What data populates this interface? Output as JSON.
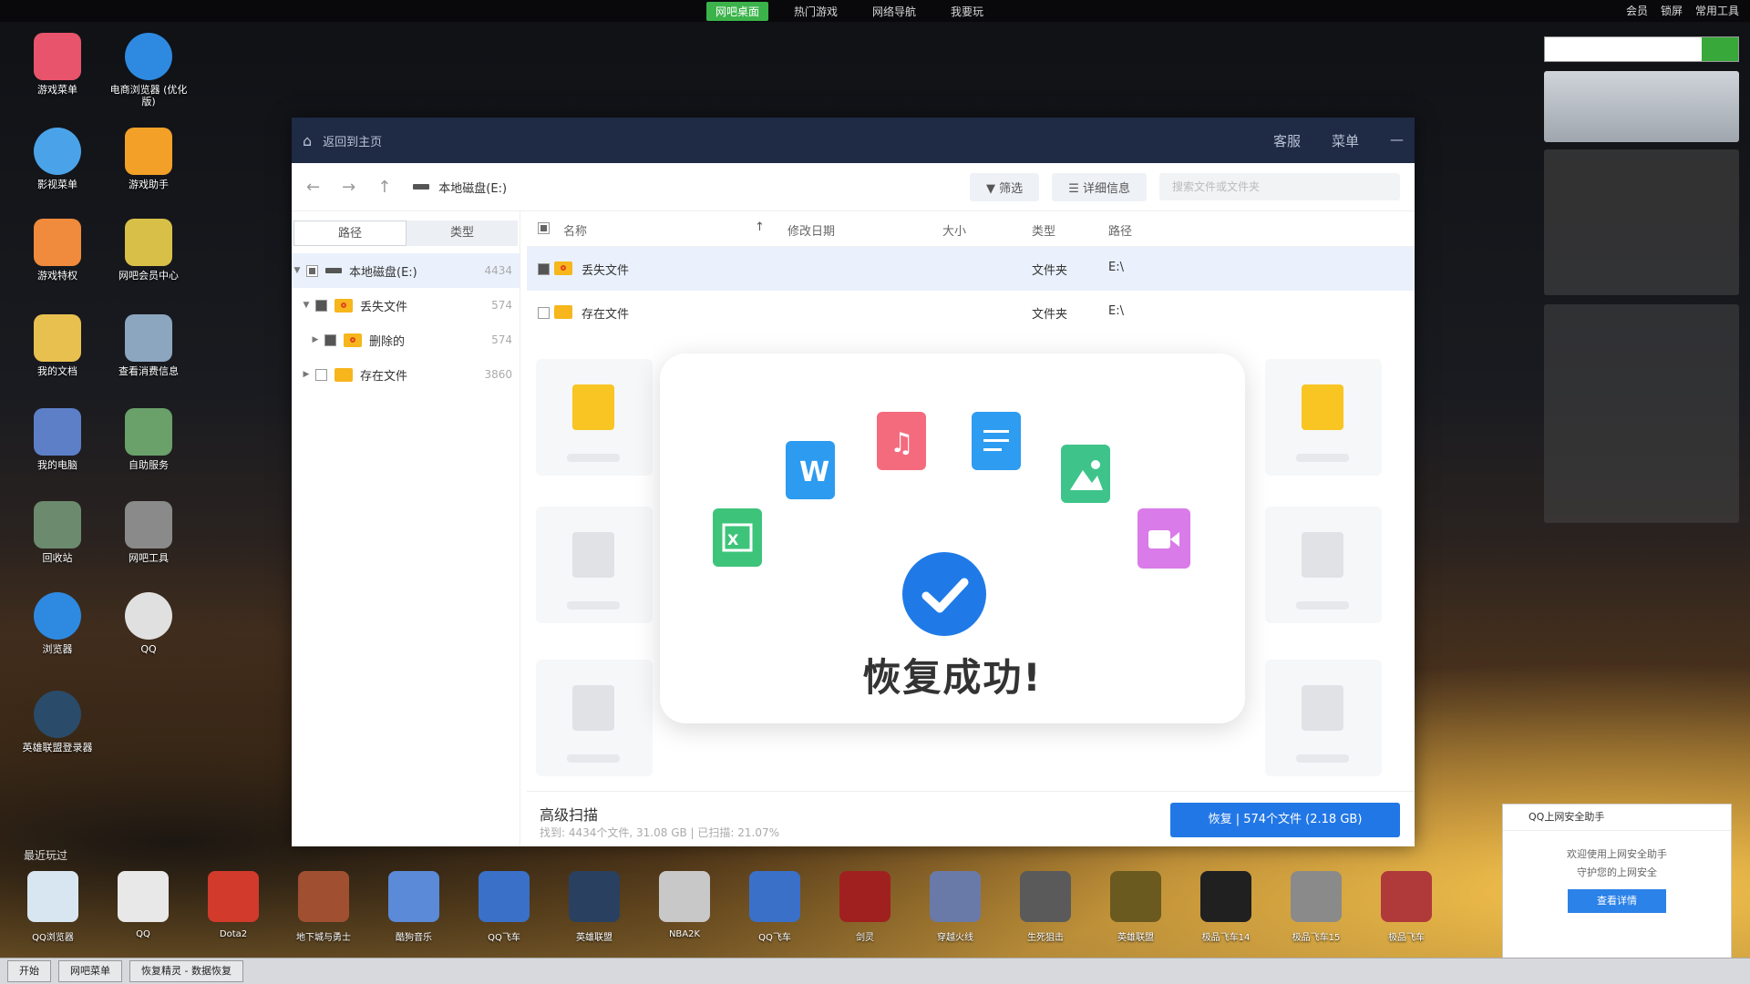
{
  "topbar": {
    "items": [
      "网吧桌面",
      "热门游戏",
      "网络导航",
      "我要玩"
    ],
    "right": [
      "会员",
      "锁屏",
      "常用工具"
    ]
  },
  "desktop_icons": [
    {
      "label": "游戏菜单"
    },
    {
      "label": "电商浏览器 (优化版)"
    },
    {
      "label": "影视菜单"
    },
    {
      "label": "游戏助手"
    },
    {
      "label": "游戏特权"
    },
    {
      "label": "网吧会员中心"
    },
    {
      "label": "我的文档"
    },
    {
      "label": "查看消费信息"
    },
    {
      "label": "我的电脑"
    },
    {
      "label": "自助服务"
    },
    {
      "label": "回收站"
    },
    {
      "label": "网吧工具"
    },
    {
      "label": "浏览器"
    },
    {
      "label": "QQ"
    },
    {
      "label": "英雄联盟登录器"
    }
  ],
  "window": {
    "title": "返回到主页",
    "controls": [
      "客服",
      "菜单",
      "—"
    ],
    "path": "本地磁盘(E:)",
    "filter_label": "筛选",
    "detail_label": "详细信息",
    "search_placeholder": "搜索文件或文件夹"
  },
  "sidebar": {
    "tabs": [
      "路径",
      "类型"
    ],
    "tree": [
      {
        "label": "本地磁盘(E:)",
        "count": "4434"
      },
      {
        "label": "丢失文件",
        "count": "574"
      },
      {
        "label": "删除的",
        "count": "574"
      },
      {
        "label": "存在文件",
        "count": "3860"
      }
    ]
  },
  "table": {
    "headers": [
      "名称",
      "修改日期",
      "大小",
      "类型",
      "路径"
    ],
    "rows": [
      {
        "name": "丢失文件",
        "type": "文件夹",
        "path": "E:\\"
      },
      {
        "name": "存在文件",
        "type": "文件夹",
        "path": "E:\\"
      }
    ]
  },
  "modal": {
    "message": "恢复成功!",
    "file_icons": [
      "word-icon",
      "music-icon",
      "document-icon",
      "image-icon",
      "excel-icon",
      "video-icon"
    ]
  },
  "bottom": {
    "advanced": "高级扫描",
    "status": "找到: 4434个文件, 31.08 GB | 已扫描: 21.07%",
    "recover_button": "恢复 | 574个文件 (2.18 GB)"
  },
  "dock": {
    "section_label": "最近玩过",
    "items": [
      "QQ浏览器",
      "QQ",
      "Dota2",
      "地下城与勇士",
      "酷狗音乐",
      "QQ飞车",
      "英雄联盟",
      "NBA2K",
      "QQ飞车",
      "剑灵",
      "穿越火线",
      "生死狙击",
      "英雄联盟",
      "极品飞车14",
      "极品飞车15",
      "极品飞车"
    ]
  },
  "toast": {
    "title": "QQ上网安全助手",
    "line1": "欢迎使用上网安全助手",
    "line2": "守护您的上网安全",
    "button": "查看详情"
  },
  "taskbar": {
    "start": "开始",
    "task1": "网吧菜单",
    "task2": "恢复精灵 - 数据恢复"
  },
  "colors": {
    "accent": "#2277e6",
    "titlebar": "#1f2a44",
    "folder": "#f6b61c"
  }
}
